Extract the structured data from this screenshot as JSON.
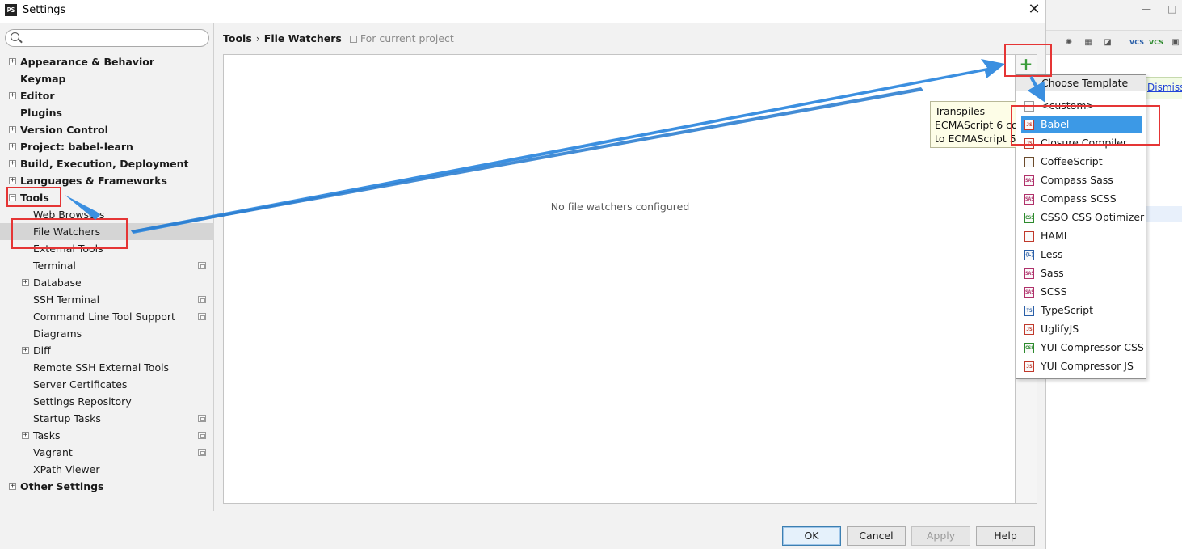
{
  "window": {
    "app_icon": "PS",
    "title": "Settings",
    "close_glyph": "✕"
  },
  "search": {
    "value": "",
    "placeholder": ""
  },
  "sidebar": {
    "items": [
      {
        "label": "Appearance & Behavior",
        "bold": true,
        "expander": "+"
      },
      {
        "label": "Keymap",
        "bold": true,
        "expander": ""
      },
      {
        "label": "Editor",
        "bold": true,
        "expander": "+"
      },
      {
        "label": "Plugins",
        "bold": true,
        "expander": ""
      },
      {
        "label": "Version Control",
        "bold": true,
        "expander": "+"
      },
      {
        "label": "Project: babel-learn",
        "bold": true,
        "expander": "+"
      },
      {
        "label": "Build, Execution, Deployment",
        "bold": true,
        "expander": "+"
      },
      {
        "label": "Languages & Frameworks",
        "bold": true,
        "expander": "+"
      },
      {
        "label": "Tools",
        "bold": true,
        "expander": "−"
      },
      {
        "label": "Web Browsers",
        "bold": false,
        "expander": ""
      },
      {
        "label": "File Watchers",
        "bold": false,
        "expander": "",
        "selected": true
      },
      {
        "label": "External Tools",
        "bold": false,
        "expander": ""
      },
      {
        "label": "Terminal",
        "bold": false,
        "expander": "",
        "project_icon": true
      },
      {
        "label": "Database",
        "bold": false,
        "expander": "+"
      },
      {
        "label": "SSH Terminal",
        "bold": false,
        "expander": "",
        "project_icon": true
      },
      {
        "label": "Command Line Tool Support",
        "bold": false,
        "expander": "",
        "project_icon": true
      },
      {
        "label": "Diagrams",
        "bold": false,
        "expander": ""
      },
      {
        "label": "Diff",
        "bold": false,
        "expander": "+"
      },
      {
        "label": "Remote SSH External Tools",
        "bold": false,
        "expander": ""
      },
      {
        "label": "Server Certificates",
        "bold": false,
        "expander": ""
      },
      {
        "label": "Settings Repository",
        "bold": false,
        "expander": ""
      },
      {
        "label": "Startup Tasks",
        "bold": false,
        "expander": "",
        "project_icon": true
      },
      {
        "label": "Tasks",
        "bold": false,
        "expander": "+",
        "project_icon": true
      },
      {
        "label": "Vagrant",
        "bold": false,
        "expander": "",
        "project_icon": true
      },
      {
        "label": "XPath Viewer",
        "bold": false,
        "expander": ""
      },
      {
        "label": "Other Settings",
        "bold": true,
        "expander": "+"
      }
    ]
  },
  "breadcrumb": {
    "parent": "Tools",
    "separator": "›",
    "current": "File Watchers",
    "scope": "For current project"
  },
  "main": {
    "empty_message": "No file watchers configured",
    "add_glyph": "+"
  },
  "tooltip": {
    "lines": [
      "Transpiles",
      "ECMAScript 6 code",
      "to ECMAScript 5"
    ]
  },
  "popup": {
    "header": "Choose Template",
    "items": [
      {
        "label": "<custom>",
        "icon": "file-icon",
        "badge": "",
        "color": "#999999"
      },
      {
        "label": "Babel",
        "icon": "js-file-icon",
        "badge": "JS",
        "color": "#c0392b",
        "selected": true
      },
      {
        "label": "Closure Compiler",
        "icon": "js-file-icon",
        "badge": "JS",
        "color": "#c0392b"
      },
      {
        "label": "CoffeeScript",
        "icon": "coffee-file-icon",
        "badge": "",
        "color": "#6b4a2b"
      },
      {
        "label": "Compass Sass",
        "icon": "sass-file-icon",
        "badge": "SASS",
        "color": "#b0306a"
      },
      {
        "label": "Compass SCSS",
        "icon": "sass-file-icon",
        "badge": "SASS",
        "color": "#b0306a"
      },
      {
        "label": "CSSO CSS Optimizer",
        "icon": "css-file-icon",
        "badge": "CSS",
        "color": "#2d8a2d"
      },
      {
        "label": "HAML",
        "icon": "haml-file-icon",
        "badge": "",
        "color": "#c0392b"
      },
      {
        "label": "Less",
        "icon": "less-file-icon",
        "badge": "{L}",
        "color": "#2a5fa8"
      },
      {
        "label": "Sass",
        "icon": "sass-file-icon",
        "badge": "SASS",
        "color": "#b0306a"
      },
      {
        "label": "SCSS",
        "icon": "sass-file-icon",
        "badge": "SASS",
        "color": "#b0306a"
      },
      {
        "label": "TypeScript",
        "icon": "ts-file-icon",
        "badge": "TS",
        "color": "#2a5fa8"
      },
      {
        "label": "UglifyJS",
        "icon": "js-file-icon",
        "badge": "JS",
        "color": "#c0392b"
      },
      {
        "label": "YUI Compressor CSS",
        "icon": "css-file-icon",
        "badge": "CSS",
        "color": "#2d8a2d"
      },
      {
        "label": "YUI Compressor JS",
        "icon": "js-file-icon",
        "badge": "JS",
        "color": "#c0392b"
      }
    ]
  },
  "buttons": {
    "ok": "OK",
    "cancel": "Cancel",
    "apply": "Apply",
    "help": "Help"
  },
  "ide_background": {
    "notification_link": "Dismiss",
    "window_controls": [
      "—",
      "□"
    ],
    "toolbar": [
      "VCS",
      "VCS"
    ]
  },
  "colors": {
    "selection": "#3c99e6",
    "annotation": "#e53535",
    "arrow": "#3b8fe0",
    "add_green": "#3a9c3a"
  }
}
